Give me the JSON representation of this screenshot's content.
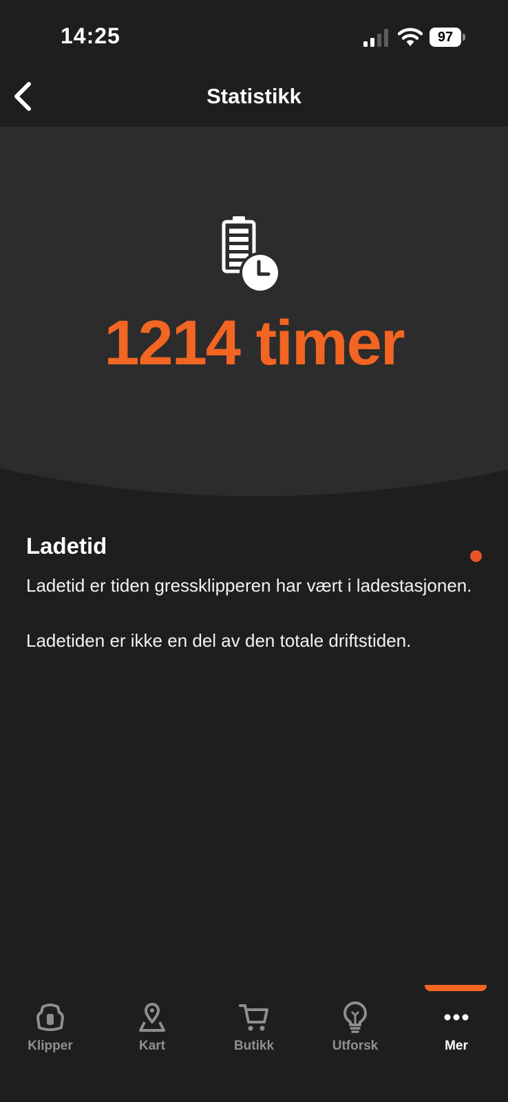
{
  "status_bar": {
    "time": "14:25",
    "battery_level": "97"
  },
  "header": {
    "title": "Statistikk",
    "back_icon": "chevron-left-icon"
  },
  "hero": {
    "icon": "battery-clock-icon",
    "value": "1214 timer",
    "accent_color": "#f26522"
  },
  "info": {
    "title": "Ladetid",
    "paragraphs": [
      "Ladetid er tiden gressklipperen har vært i ladestasjonen.",
      "Ladetiden er ikke en del av den totale driftstiden."
    ]
  },
  "bottom_nav": {
    "items": [
      {
        "label": "Klipper",
        "icon": "mower-icon",
        "active": false
      },
      {
        "label": "Kart",
        "icon": "map-pin-icon",
        "active": false
      },
      {
        "label": "Butikk",
        "icon": "cart-icon",
        "active": false
      },
      {
        "label": "Utforsk",
        "icon": "lightbulb-icon",
        "active": false
      },
      {
        "label": "Mer",
        "icon": "more-dots-icon",
        "active": true
      }
    ]
  }
}
